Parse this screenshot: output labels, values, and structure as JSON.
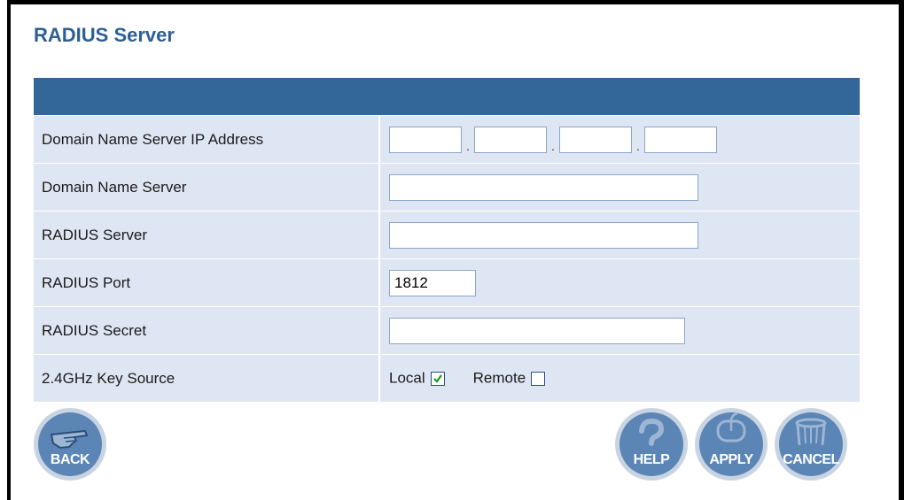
{
  "page": {
    "title": "RADIUS Server"
  },
  "form": {
    "rows": [
      {
        "label": "Domain Name Server IP Address",
        "ip_separator": "."
      },
      {
        "label": "Domain Name Server",
        "value": ""
      },
      {
        "label": "RADIUS Server",
        "value": ""
      },
      {
        "label": "RADIUS Port",
        "value": "1812"
      },
      {
        "label": "RADIUS Secret",
        "value": ""
      },
      {
        "label": "2.4GHz Key Source",
        "options": [
          {
            "label": "Local",
            "checked": true
          },
          {
            "label": "Remote",
            "checked": false
          }
        ]
      }
    ]
  },
  "buttons": {
    "back": "BACK",
    "help": "HELP",
    "apply": "APPLY",
    "cancel": "CANCEL"
  },
  "colors": {
    "title": "#2c5f94",
    "header_bar": "#336699",
    "row_bg": "#dfe6f3",
    "button_face": "#5b85b5"
  },
  "icons": {
    "back": "pointing-hand-icon",
    "help": "question-mark-icon",
    "apply": "mouse-icon",
    "cancel": "trash-can-icon"
  }
}
